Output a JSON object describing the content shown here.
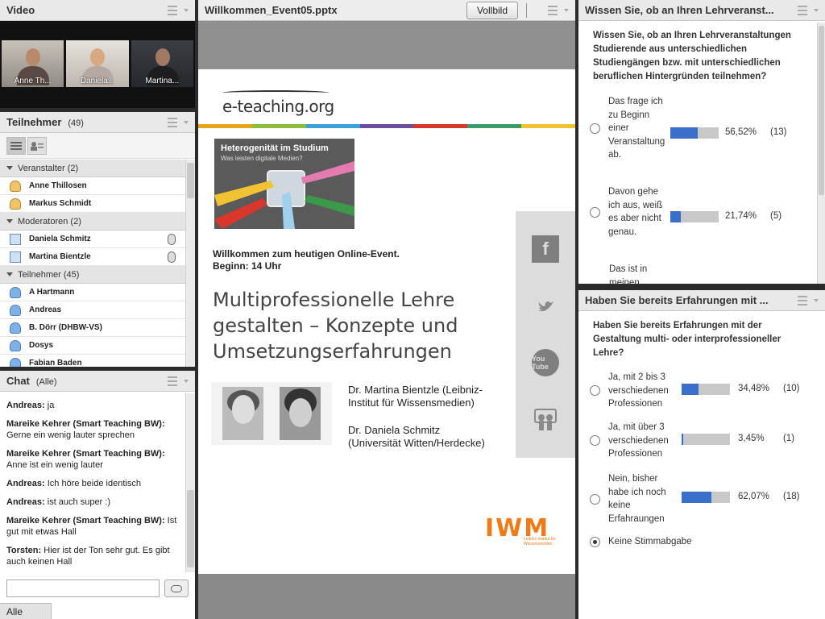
{
  "video": {
    "title": "Video",
    "participants": [
      {
        "name": "Anne Th..."
      },
      {
        "name": "Daniela..."
      },
      {
        "name": "Martina..."
      }
    ]
  },
  "attendees": {
    "title": "Teilnehmer",
    "count": "(49)",
    "groups": [
      {
        "label": "Veranstalter (2)",
        "members": [
          "Anne Thillosen",
          "Markus Schmidt"
        ]
      },
      {
        "label": "Moderatoren (2)",
        "members": [
          "Daniela Schmitz",
          "Martina Bientzle"
        ]
      },
      {
        "label": "Teilnehmer (45)",
        "members": [
          "A Hartmann",
          "Andreas",
          "B. Dörr (DHBW-VS)",
          "Dosys",
          "Fabian Baden"
        ]
      }
    ]
  },
  "chat": {
    "title": "Chat",
    "scope": "(Alle)",
    "messages": [
      {
        "sender": "Andreas:",
        "text": " ja"
      },
      {
        "sender": "Mareike Kehrer (Smart Teaching BW):",
        "text": " Gerne ein wenig lauter sprechen"
      },
      {
        "sender": "Mareike Kehrer (Smart Teaching BW):",
        "text": " Anne ist ein wenig lauter"
      },
      {
        "sender": "Andreas:",
        "text": " Ich höre beide identisch"
      },
      {
        "sender": "Andreas:",
        "text": " ist auch super :)"
      },
      {
        "sender": "Mareike Kehrer (Smart Teaching BW):",
        "text": " Ist gut mit etwas Hall"
      },
      {
        "sender": "Torsten:",
        "text": " Hier ist der Ton sehr gut. Es gibt auch keinen Hall"
      }
    ],
    "input_placeholder": "",
    "tab_label": "Alle"
  },
  "share": {
    "title": "Willkommen_Event05.pptx",
    "fullscreen_label": "Vollbild",
    "slide": {
      "logo": "e-teaching.org",
      "image_title": "Heterogenität im Studium",
      "image_subtitle": "Was leisten digitale Medien?",
      "welcome_line1": "Willkommen zum heutigen Online-Event.",
      "welcome_line2": "Beginn: 14 Uhr",
      "title_line1": "Multiprofessionelle Lehre",
      "title_line2": "gestalten – Konzepte und",
      "title_line3": "Umsetzungserfahrungen",
      "author1_line1": "Dr. Martina Bientzle (Leibniz-",
      "author1_line2": "Institut für Wissensmedien)",
      "author2_line1": "Dr. Daniela Schmitz",
      "author2_line2": "(Universität Witten/Herdecke)",
      "iwm_logo": "IWM",
      "iwm_sub": "Leibniz-Institut für Wissensmedien",
      "social_icons": [
        "facebook-icon",
        "twitter-icon",
        "youtube-icon",
        "slideshare-icon"
      ]
    }
  },
  "poll1": {
    "title": "Wissen Sie, ob an Ihren Lehrveranst...",
    "question": "Wissen Sie, ob an Ihren Lehrveranstaltungen Studierende aus unterschiedlichen Studiengängen bzw. mit unterschiedlichen beruflichen Hintergründen teilnehmen?",
    "options": [
      {
        "label": "Das frage ich zu Beginn einer Veranstaltung ab.",
        "percent": "56,52%",
        "count": "(13)",
        "fraction": 0.5652
      },
      {
        "label": "Davon gehe ich aus, weiß es aber nicht genau.",
        "percent": "21,74%",
        "count": "(5)",
        "fraction": 0.2174
      },
      {
        "label": "Das ist in meinen",
        "percent": "",
        "count": "",
        "fraction": 0
      }
    ]
  },
  "poll2": {
    "title": "Haben Sie bereits Erfahrungen mit ...",
    "question": "Haben Sie bereits Erfahrungen mit der Gestaltung multi- oder interprofessioneller Lehre?",
    "options": [
      {
        "label": "Ja, mit 2 bis 3 verschiedenen Professionen",
        "percent": "34,48%",
        "count": "(10)",
        "fraction": 0.3448
      },
      {
        "label": "Ja, mit über 3 verschiedenen Professionen",
        "percent": "3,45%",
        "count": "(1)",
        "fraction": 0.0345
      },
      {
        "label": "Nein, bisher habe ich noch keine Erfahraungen",
        "percent": "62,07%",
        "count": "(18)",
        "fraction": 0.6207
      }
    ],
    "abstain_label": "Keine Stimmabgabe"
  },
  "colors": {
    "bar_fill": "#3a6fc9",
    "iwm_orange": "#f07a16",
    "stripe": [
      "#e8a419",
      "#8dbb3c",
      "#3aa2d9",
      "#6c4e9e",
      "#d9372b",
      "#3a9a6a",
      "#f1c232"
    ]
  }
}
